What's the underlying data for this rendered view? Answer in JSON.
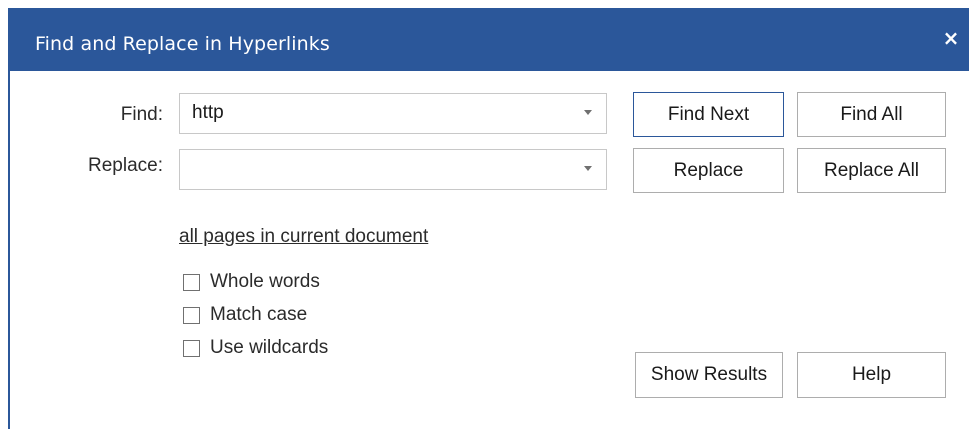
{
  "dialog": {
    "title": "Find and Replace in Hyperlinks",
    "close_icon": "×"
  },
  "find": {
    "label": "Find:",
    "value": "http",
    "placeholder": ""
  },
  "replace": {
    "label": "Replace:",
    "value": "",
    "placeholder": ""
  },
  "buttons": {
    "find_next": "Find Next",
    "find_all": "Find All",
    "replace": "Replace",
    "replace_all": "Replace All",
    "show_results": "Show Results",
    "help": "Help"
  },
  "scope_link": "all pages in current document",
  "options": {
    "whole_words": {
      "label": "Whole words",
      "checked": false
    },
    "match_case": {
      "label": "Match case",
      "checked": false
    },
    "use_wildcards": {
      "label": "Use wildcards",
      "checked": false
    }
  },
  "colors": {
    "titlebar": "#2b579a",
    "default_button_border": "#2b579a"
  }
}
